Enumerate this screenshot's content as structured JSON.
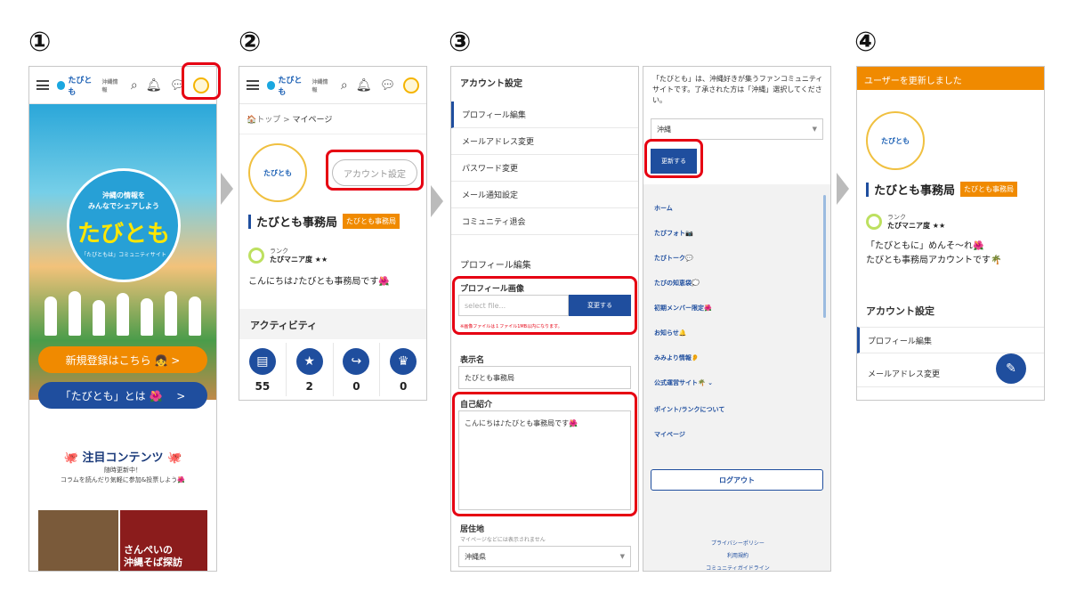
{
  "steps": [
    "①",
    "②",
    "③",
    "④"
  ],
  "header": {
    "logo_text": "たびとも",
    "logo_sub": "沖縄情報"
  },
  "panel1": {
    "hero_sub": "沖縄の情報を\nみんなでシェアしよう",
    "hero_title": "たびとも",
    "hero_tiny": "「たびともは」コミュニティサイト",
    "signup_button": "新規登録はこちら 👧 >",
    "about_button": "「たびとも」とは 🌺 　>",
    "featured_title": "🐙 注目コンテンツ 🐙",
    "featured_sub1": "随時更新中！",
    "featured_sub2": "コラムを読んだり気軽に参加&投票しよう🌺",
    "thumb_text": "さんぺいの\n沖縄そば探訪"
  },
  "panel2": {
    "breadcrumb_home": "🏠トップ",
    "breadcrumb_sep": ">",
    "breadcrumb_current": "マイページ",
    "avatar_text": "たびとも",
    "account_settings_button": "アカウント設定",
    "name": "たびとも事務局",
    "badge": "たびとも事務局",
    "rank_label": "ランク",
    "rank_value": "たびマニア度 ★★",
    "greeting": "こんにちは♪たびとも事務局です🌺",
    "activity_title": "アクティビティ",
    "activity_icons": [
      "▤",
      "★",
      "↪",
      "♛"
    ],
    "activity_counts": [
      "55",
      "2",
      "0",
      "0"
    ]
  },
  "panel3": {
    "account_settings_title": "アカウント設定",
    "menu": [
      "プロフィール編集",
      "メールアドレス変更",
      "パスワード変更",
      "メール通知設定",
      "コミュニティ退会"
    ],
    "profile_edit_title": "プロフィール編集",
    "profile_image_label": "プロフィール画像",
    "file_placeholder": "select file...",
    "change_button": "変更する",
    "image_error": "※画像ファイルは１ファイル1MB以内になります。",
    "display_name_label": "表示名",
    "display_name_value": "たびとも事務局",
    "bio_label": "自己紹介",
    "bio_value": "こんにちは♪たびとも事務局です🌺",
    "residence_label": "居住地",
    "residence_sub": "マイページなどには表示されません",
    "residence_value": "沖縄県"
  },
  "panel4": {
    "intro": "「たびとも」は、沖縄好きが集うファンコミュニティサイトです。了承された方は「沖縄」選択してください。",
    "select_value": "沖縄",
    "update_button": "更新する",
    "nav": [
      "ホーム",
      "たびフォト📷",
      "たびトーク💬",
      "たびの知恵袋💭",
      "初期メンバー限定🌺",
      "お知らせ🔔",
      "みみより情報👂",
      "公式運営サイト🌴 ⌄",
      "ポイント/ランクについて",
      "マイページ"
    ],
    "logout": "ログアウト",
    "footer": [
      "プライバシーポリシー",
      "利用規約",
      "コミュニティガイドライン"
    ]
  },
  "panel5": {
    "toast": "ユーザーを更新しました",
    "avatar_text": "たびとも",
    "name": "たびとも事務局",
    "badge": "たびとも事務局",
    "rank_label": "ランク",
    "rank_value": "たびマニア度 ★★",
    "bio_line1": "「たびともに」めんそ〜れ🌺",
    "bio_line2": "たびとも事務局アカウントです🌴",
    "account_settings_title": "アカウント設定",
    "menu": [
      "プロフィール編集",
      "メールアドレス変更"
    ],
    "fab_icon": "✎"
  },
  "colors": {
    "accent_red": "#e60012",
    "brand_blue": "#1f4e9e",
    "brand_orange": "#f08a00"
  }
}
